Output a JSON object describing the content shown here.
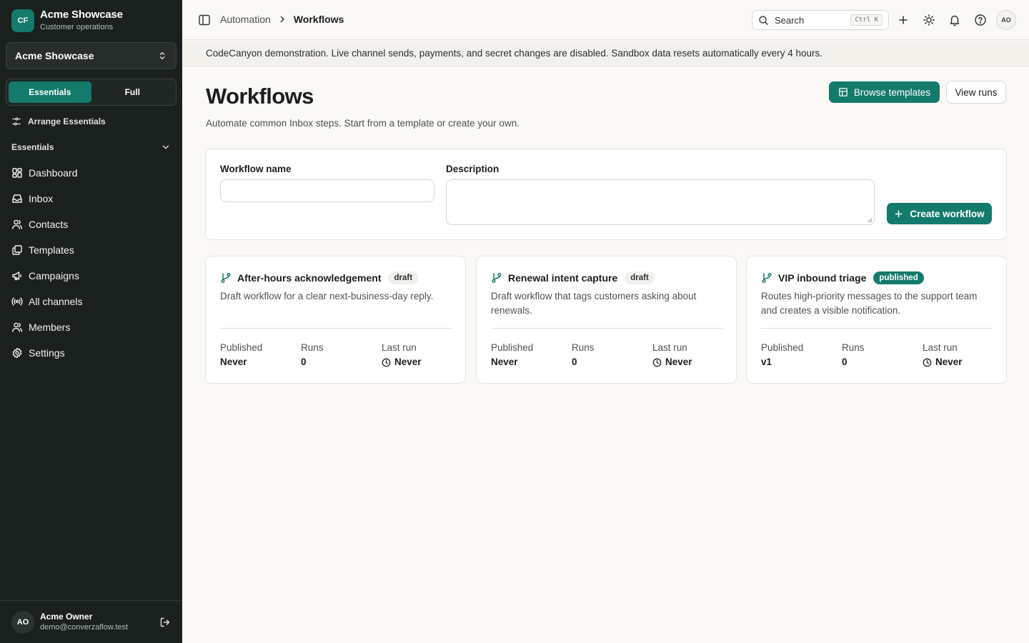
{
  "brand": {
    "initials": "CF",
    "name": "Acme Showcase",
    "subtitle": "Customer operations"
  },
  "workspace": {
    "selected": "Acme Showcase"
  },
  "mode_toggle": {
    "options": [
      "Essentials",
      "Full"
    ],
    "active": "Essentials"
  },
  "sidebar": {
    "arrange_label": "Arrange Essentials",
    "section_label": "Essentials",
    "items": [
      {
        "label": "Dashboard",
        "icon": "dashboard-icon"
      },
      {
        "label": "Inbox",
        "icon": "inbox-icon"
      },
      {
        "label": "Contacts",
        "icon": "contacts-icon"
      },
      {
        "label": "Templates",
        "icon": "templates-icon"
      },
      {
        "label": "Campaigns",
        "icon": "megaphone-icon"
      },
      {
        "label": "All channels",
        "icon": "channels-icon"
      },
      {
        "label": "Members",
        "icon": "members-icon"
      },
      {
        "label": "Settings",
        "icon": "gear-icon"
      }
    ]
  },
  "user": {
    "initials": "AO",
    "name": "Acme Owner",
    "email": "demo@converzaflow.test"
  },
  "topbar": {
    "breadcrumb": [
      "Automation",
      "Workflows"
    ],
    "search_placeholder": "Search",
    "search_shortcut": "Ctrl K",
    "avatar_initials": "AO"
  },
  "banner": "CodeCanyon demonstration. Live channel sends, payments, and secret changes are disabled. Sandbox data resets automatically every 4 hours.",
  "page": {
    "title": "Workflows",
    "subtitle": "Automate common Inbox steps. Start from a template or create your own.",
    "browse_label": "Browse templates",
    "runs_label": "View runs"
  },
  "create_form": {
    "name_label": "Workflow name",
    "name_value": "",
    "description_label": "Description",
    "description_value": "",
    "submit_label": "Create workflow"
  },
  "stat_labels": {
    "published": "Published",
    "runs": "Runs",
    "last_run": "Last run"
  },
  "workflows": [
    {
      "name": "After-hours acknowledgement",
      "status": "draft",
      "description": "Draft workflow for a clear next-business-day reply.",
      "published": "Never",
      "runs": "0",
      "last_run": "Never"
    },
    {
      "name": "Renewal intent capture",
      "status": "draft",
      "description": "Draft workflow that tags customers asking about renewals.",
      "published": "Never",
      "runs": "0",
      "last_run": "Never"
    },
    {
      "name": "VIP inbound triage",
      "status": "published",
      "description": "Routes high-priority messages to the support team and creates a visible notification.",
      "published": "v1",
      "runs": "0",
      "last_run": "Never"
    }
  ],
  "colors": {
    "accent": "#137a6c",
    "sidebar_bg": "#1a201e",
    "page_bg": "#faf9f6"
  }
}
